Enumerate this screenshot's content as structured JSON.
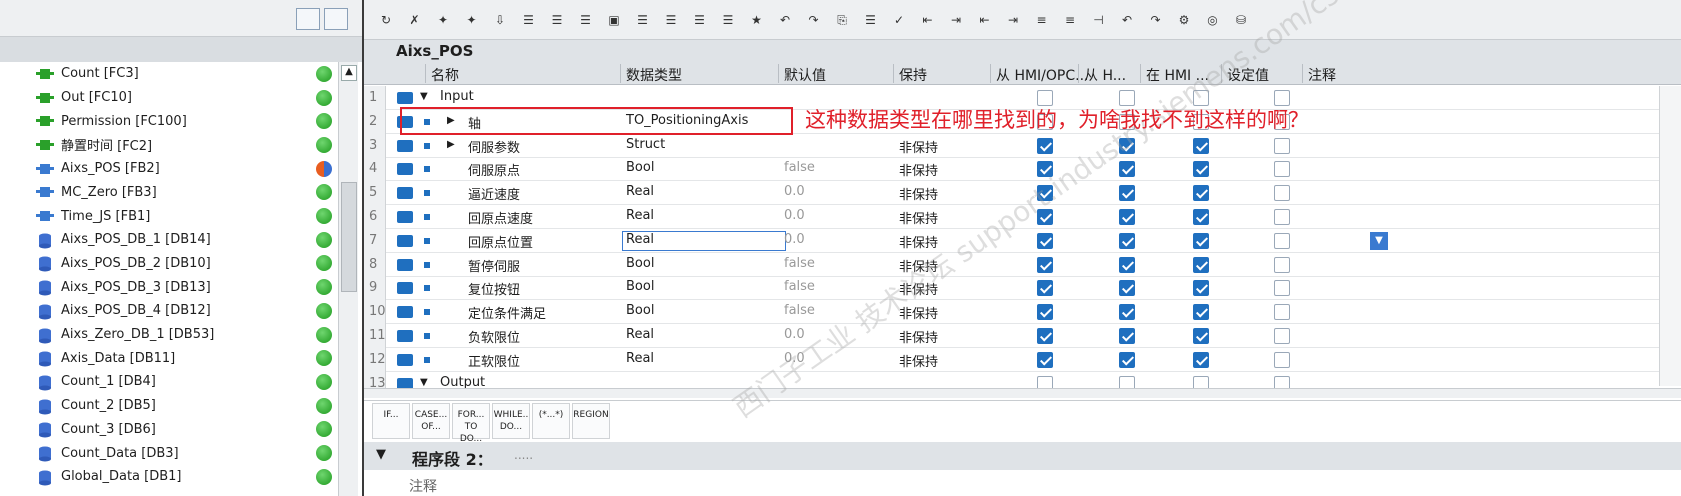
{
  "project_tree": {
    "items": [
      {
        "label": "Count [FC3]",
        "kind": "fc"
      },
      {
        "label": "Out [FC10]",
        "kind": "fc"
      },
      {
        "label": "Permission [FC100]",
        "kind": "fc"
      },
      {
        "label": "静置时间 [FC2]",
        "kind": "fc"
      },
      {
        "label": "Aixs_POS [FB2]",
        "kind": "fb"
      },
      {
        "label": "MC_Zero [FB3]",
        "kind": "fb"
      },
      {
        "label": "Time_JS [FB1]",
        "kind": "fb"
      },
      {
        "label": "Aixs_POS_DB_1 [DB14]",
        "kind": "db"
      },
      {
        "label": "Aixs_POS_DB_2 [DB10]",
        "kind": "db"
      },
      {
        "label": "Aixs_POS_DB_3 [DB13]",
        "kind": "db"
      },
      {
        "label": "Aixs_POS_DB_4 [DB12]",
        "kind": "db"
      },
      {
        "label": "Aixs_Zero_DB_1 [DB53]",
        "kind": "db"
      },
      {
        "label": "Axis_Data [DB11]",
        "kind": "db"
      },
      {
        "label": "Count_1 [DB4]",
        "kind": "db"
      },
      {
        "label": "Count_2 [DB5]",
        "kind": "db"
      },
      {
        "label": "Count_3 [DB6]",
        "kind": "db"
      },
      {
        "label": "Count_Data [DB3]",
        "kind": "db"
      },
      {
        "label": "Global_Data [DB1]",
        "kind": "db"
      }
    ],
    "status_color": "#22a822"
  },
  "editor": {
    "block_name": "Aixs_POS",
    "columns": [
      "名称",
      "数据类型",
      "默认值",
      "保持",
      "从 HMI/OPC...",
      "从 H...",
      "在 HMI ...",
      "设定值",
      "注释"
    ],
    "rows": [
      {
        "num": "1",
        "name": "Input",
        "type": "",
        "default": "",
        "retain": "",
        "expand": "▼",
        "section": true
      },
      {
        "num": "2",
        "name": "轴",
        "type": "TO_PositioningAxis",
        "default": "",
        "retain": "",
        "expand": "▶",
        "section": false
      },
      {
        "num": "3",
        "name": "伺服参数",
        "type": "Struct",
        "default": "",
        "retain": "非保持",
        "expand": "▶",
        "section": false
      },
      {
        "num": "4",
        "name": "伺服原点",
        "type": "Bool",
        "default": "false",
        "retain": "非保持",
        "expand": "",
        "section": false
      },
      {
        "num": "5",
        "name": "逼近速度",
        "type": "Real",
        "default": "0.0",
        "retain": "非保持",
        "expand": "",
        "section": false
      },
      {
        "num": "6",
        "name": "回原点速度",
        "type": "Real",
        "default": "0.0",
        "retain": "非保持",
        "expand": "",
        "section": false
      },
      {
        "num": "7",
        "name": "回原点位置",
        "type": "Real",
        "default": "0.0",
        "retain": "非保持",
        "expand": "",
        "section": false
      },
      {
        "num": "8",
        "name": "暂停伺服",
        "type": "Bool",
        "default": "false",
        "retain": "非保持",
        "expand": "",
        "section": false
      },
      {
        "num": "9",
        "name": "复位按钮",
        "type": "Bool",
        "default": "false",
        "retain": "非保持",
        "expand": "",
        "section": false
      },
      {
        "num": "10",
        "name": "定位条件满足",
        "type": "Bool",
        "default": "false",
        "retain": "非保持",
        "expand": "",
        "section": false
      },
      {
        "num": "11",
        "name": "负软限位",
        "type": "Real",
        "default": "0.0",
        "retain": "非保持",
        "expand": "",
        "section": false
      },
      {
        "num": "12",
        "name": "正软限位",
        "type": "Real",
        "default": "0.0",
        "retain": "非保持",
        "expand": "",
        "section": false
      },
      {
        "num": "13",
        "name": "Output",
        "type": "",
        "default": "",
        "retain": "",
        "expand": "▼",
        "section": true
      }
    ],
    "annotation": "这种数据类型在哪里找到的，为啥我找不到这样的啊？",
    "watermark": "西门子工业 技术论坛 support.industry.siemens.com/cs"
  },
  "instructions": [
    {
      "line1": "IF...",
      "line2": ""
    },
    {
      "line1": "CASE...",
      "line2": "OF..."
    },
    {
      "line1": "FOR...",
      "line2": "TO DO..."
    },
    {
      "line1": "WHILE..",
      "line2": "DO..."
    },
    {
      "line1": "(*...*)",
      "line2": ""
    },
    {
      "line1": "REGION",
      "line2": ""
    }
  ],
  "network": {
    "title": "程序段 2：",
    "dots": ".....",
    "comment": "注释"
  }
}
